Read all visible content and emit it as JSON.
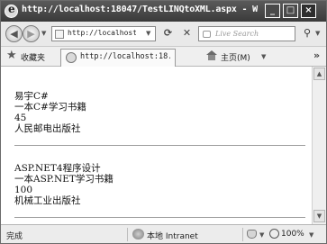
{
  "window": {
    "title": "http://localhost:18047/TestLINQtoXML.aspx - W..."
  },
  "titlebar_buttons": {
    "minimize": "_",
    "maximize": "□",
    "close": "×"
  },
  "address_bar": {
    "url": "http://localhost:1",
    "search_placeholder": "Live Search"
  },
  "favorites_bar": {
    "favorites_label": "收藏夹",
    "tab_label": "http://localhost:18...",
    "home_label": "主页(M)",
    "more": "»"
  },
  "books": [
    {
      "author": "易宇C#",
      "title": "一本C#学习书籍",
      "price": "45",
      "publisher": "人民邮电出版社"
    },
    {
      "author": "ASP.NET4程序设计",
      "title": "一本ASP.NET学习书籍",
      "price": "100",
      "publisher": "机械工业出版社"
    }
  ],
  "status_bar": {
    "status": "完成",
    "zone": "本地 Intranet",
    "zoom": "100%"
  }
}
